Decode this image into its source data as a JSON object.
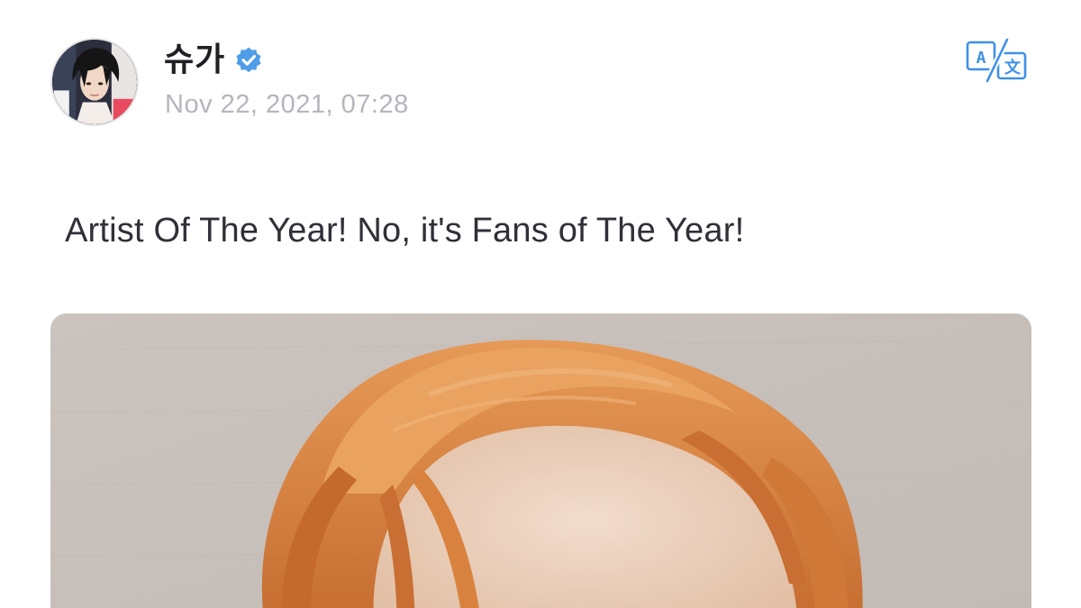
{
  "post": {
    "author": {
      "name": "슈가",
      "verified": true,
      "avatar_icon": "profile-photo"
    },
    "timestamp": "Nov 22, 2021, 07:28",
    "text": "Artist Of The Year! No, it's Fans of The Year!",
    "translate_icon": "translate-icon",
    "photo": {
      "icon": "photo-selfie"
    }
  },
  "colors": {
    "verified_blue": "#4f9de8",
    "accent_blue": "#3f90e6",
    "timestamp_gray": "#b3b6bc",
    "text_dark": "#2f3137",
    "hair_orange": "#d9823f",
    "wall_gray": "#cbc4bf"
  }
}
